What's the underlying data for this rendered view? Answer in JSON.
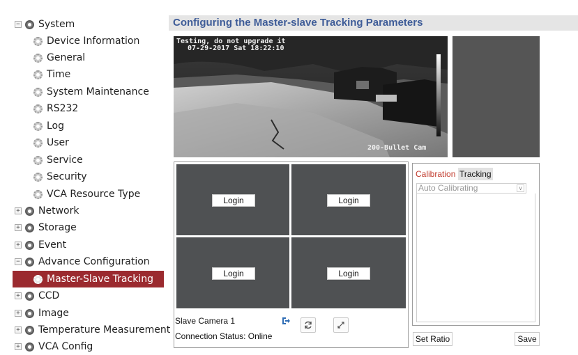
{
  "sidebar": {
    "items": [
      {
        "label": "System",
        "expander": "−"
      },
      {
        "label": "Device Information"
      },
      {
        "label": "General"
      },
      {
        "label": "Time"
      },
      {
        "label": "System Maintenance"
      },
      {
        "label": "RS232"
      },
      {
        "label": "Log"
      },
      {
        "label": "User"
      },
      {
        "label": "Service"
      },
      {
        "label": "Security"
      },
      {
        "label": "VCA Resource Type"
      },
      {
        "label": "Network",
        "expander": "+"
      },
      {
        "label": "Storage",
        "expander": "+"
      },
      {
        "label": "Event",
        "expander": "+"
      },
      {
        "label": "Advance Configuration",
        "expander": "−"
      },
      {
        "label": "Master-Slave Tracking",
        "selected": true
      },
      {
        "label": "CCD",
        "expander": "+"
      },
      {
        "label": "Image",
        "expander": "+"
      },
      {
        "label": "Temperature Measurement",
        "expander": "+"
      },
      {
        "label": "VCA Config",
        "expander": "+"
      }
    ],
    "selected_color": "#9b2a2f"
  },
  "main": {
    "title": "Configuring the Master-slave Tracking Parameters",
    "title_color": "#3e5c98",
    "video": {
      "osd_line1": "Testing, do not upgrade it",
      "osd_line2": "07-29-2017 Sat 18:22:10",
      "osd_camera": "200-Bullet Cam"
    },
    "slave_grid": {
      "login_label": "Login",
      "cells": [
        "Login",
        "Login",
        "Login",
        "Login"
      ]
    },
    "slave_camera_label": "Slave Camera 1",
    "connection_status": "Connection Status: Online",
    "calibration": {
      "tab_calibration": "Calibration",
      "tab_tracking": "Tracking",
      "mode_value": "Auto Calibrating"
    },
    "buttons": {
      "set_ratio": "Set Ratio",
      "save": "Save"
    }
  }
}
